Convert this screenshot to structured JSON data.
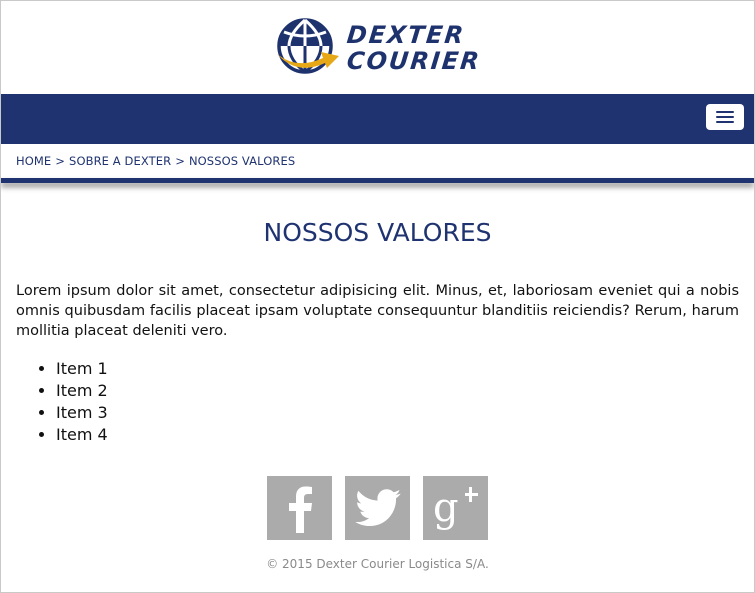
{
  "header": {
    "brand_line1": "DEXTER",
    "brand_line2": "COURIER",
    "colors": {
      "navy": "#1f3370",
      "gold": "#e6a817"
    }
  },
  "navbar": {
    "menu_icon": "hamburger-menu-icon",
    "background": "#1f3370"
  },
  "breadcrumb": {
    "items": [
      "HOME",
      "SOBRE A DEXTER",
      "NOSSOS VALORES"
    ],
    "separator": ">"
  },
  "main": {
    "title": "NOSSOS VALORES",
    "intro": "Lorem ipsum dolor sit amet, consectetur adipisicing elit. Minus, et, laboriosam eveniet qui a nobis omnis quibusdam facilis placeat ipsam voluptate consequuntur blanditiis reiciendis? Rerum, harum mollitia placeat deleniti vero.",
    "items": [
      "Item 1",
      "Item 2",
      "Item 3",
      "Item 4"
    ]
  },
  "social": {
    "icons": [
      "facebook-icon",
      "twitter-icon",
      "google-plus-icon"
    ],
    "tile_color": "#ababab"
  },
  "footer": {
    "copyright": "© 2015 Dexter Courier Logistica S/A."
  }
}
